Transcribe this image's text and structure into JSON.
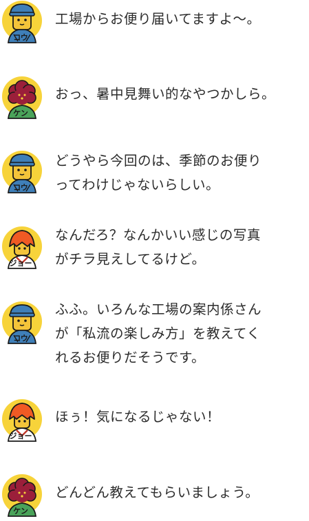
{
  "colors": {
    "avatar_bg": "#f7d33a",
    "outline": "#1a1a1a",
    "kou_hat": "#3f7fb8",
    "kou_face": "#f4c43a",
    "ken_hair": "#9b1f3a",
    "joe_hair": "#f05a24",
    "text": "#2b2b2b"
  },
  "messages": [
    {
      "speaker": "kou",
      "name": "コウ",
      "icon": "kou-avatar-icon",
      "text": "工場からお便り届いてますよ〜。"
    },
    {
      "speaker": "ken",
      "name": "ケン",
      "icon": "ken-avatar-icon",
      "text": "おっ、暑中見舞い的なやつかしら。"
    },
    {
      "speaker": "kou",
      "name": "コウ",
      "icon": "kou-avatar-icon",
      "text": "どうやら今回のは、季節のお便り\nってわけじゃないらしい。"
    },
    {
      "speaker": "joe",
      "name": "ジョー",
      "icon": "joe-avatar-icon",
      "text": "なんだろ？なんかいい感じの写真\nがチラ見えしてるけど。"
    },
    {
      "speaker": "kou",
      "name": "コウ",
      "icon": "kou-avatar-icon",
      "text": "ふふ。いろんな工場の案内係さん\nが「私流の楽しみ方」を教えてく\nれるお便りだそうです。"
    },
    {
      "speaker": "joe",
      "name": "ジョー",
      "icon": "joe-avatar-icon",
      "text": "ほぅ！気になるじゃない！"
    },
    {
      "speaker": "ken",
      "name": "ケン",
      "icon": "ken-avatar-icon",
      "text": "どんどん教えてもらいましょう。"
    }
  ]
}
